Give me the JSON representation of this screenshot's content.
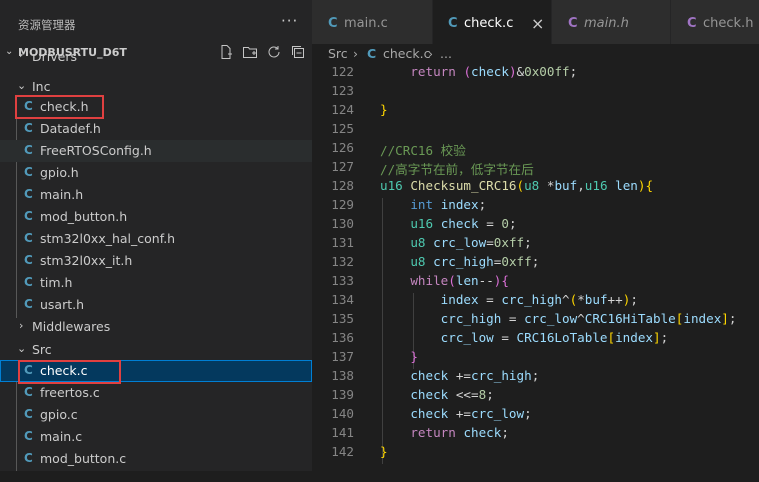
{
  "sidebar": {
    "title": "资源管理器",
    "more": "···",
    "project": "MODBUSRTU_D6T",
    "rows": [
      {
        "label": "Drivers",
        "kind": "folder",
        "chev": "›"
      },
      {
        "label": "Inc",
        "kind": "folder",
        "chev": "⌄"
      },
      {
        "label": "check.h",
        "kind": "file"
      },
      {
        "label": "Datadef.h",
        "kind": "file"
      },
      {
        "label": "FreeRTOSConfig.h",
        "kind": "file"
      },
      {
        "label": "gpio.h",
        "kind": "file"
      },
      {
        "label": "main.h",
        "kind": "file"
      },
      {
        "label": "mod_button.h",
        "kind": "file"
      },
      {
        "label": "stm32l0xx_hal_conf.h",
        "kind": "file"
      },
      {
        "label": "stm32l0xx_it.h",
        "kind": "file"
      },
      {
        "label": "tim.h",
        "kind": "file"
      },
      {
        "label": "usart.h",
        "kind": "file"
      },
      {
        "label": "Middlewares",
        "kind": "folder",
        "chev": "›"
      },
      {
        "label": "Src",
        "kind": "folder",
        "chev": "⌄"
      },
      {
        "label": "check.c",
        "kind": "file"
      },
      {
        "label": "freertos.c",
        "kind": "file"
      },
      {
        "label": "gpio.c",
        "kind": "file"
      },
      {
        "label": "main.c",
        "kind": "file"
      },
      {
        "label": "mod_button.c",
        "kind": "file"
      }
    ],
    "file_icon_glyph": "C",
    "file_icon_color": "#519aba"
  },
  "tabs": [
    {
      "label": "main.c",
      "icon_color": "#519aba"
    },
    {
      "label": "check.c",
      "icon_color": "#519aba",
      "close": "×"
    },
    {
      "label": "main.h",
      "icon_color": "#a074c4"
    },
    {
      "label": "check.h",
      "icon_color": "#a074c4"
    }
  ],
  "breadcrumb": {
    "src": "Src",
    "sep1": "›",
    "file": "check.c",
    "sep2": "›",
    "ellipsis": "..."
  },
  "editor": {
    "line_numbers": [
      "122",
      "123",
      "124",
      "125",
      "126",
      "127",
      "128",
      "129",
      "130",
      "131",
      "132",
      "133",
      "134",
      "135",
      "136",
      "137",
      "138",
      "139",
      "140",
      "141",
      "142"
    ]
  },
  "colors": {
    "highlight_box": "#e04040",
    "selection": "#04395e"
  }
}
